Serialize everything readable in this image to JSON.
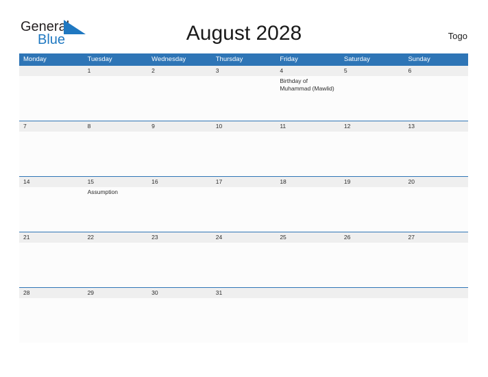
{
  "brand": {
    "word_one": "General",
    "word_two": "Blue",
    "flag_icon": "blue-flag-triangle-icon",
    "color_dark": "#231f20",
    "color_blue": "#1f78c1"
  },
  "header": {
    "title": "August 2028",
    "country": "Togo",
    "header_bg": "#2e75b6",
    "date_band_bg": "#efefef"
  },
  "calendar": {
    "weekdays": [
      "Monday",
      "Tuesday",
      "Wednesday",
      "Thursday",
      "Friday",
      "Saturday",
      "Sunday"
    ],
    "weeks": [
      {
        "days": [
          {
            "num": "",
            "events": []
          },
          {
            "num": "1",
            "events": []
          },
          {
            "num": "2",
            "events": []
          },
          {
            "num": "3",
            "events": []
          },
          {
            "num": "4",
            "events": [
              "Birthday of Muhammad (Mawlid)"
            ]
          },
          {
            "num": "5",
            "events": []
          },
          {
            "num": "6",
            "events": []
          }
        ]
      },
      {
        "days": [
          {
            "num": "7",
            "events": []
          },
          {
            "num": "8",
            "events": []
          },
          {
            "num": "9",
            "events": []
          },
          {
            "num": "10",
            "events": []
          },
          {
            "num": "11",
            "events": []
          },
          {
            "num": "12",
            "events": []
          },
          {
            "num": "13",
            "events": []
          }
        ]
      },
      {
        "days": [
          {
            "num": "14",
            "events": []
          },
          {
            "num": "15",
            "events": [
              "Assumption"
            ]
          },
          {
            "num": "16",
            "events": []
          },
          {
            "num": "17",
            "events": []
          },
          {
            "num": "18",
            "events": []
          },
          {
            "num": "19",
            "events": []
          },
          {
            "num": "20",
            "events": []
          }
        ]
      },
      {
        "days": [
          {
            "num": "21",
            "events": []
          },
          {
            "num": "22",
            "events": []
          },
          {
            "num": "23",
            "events": []
          },
          {
            "num": "24",
            "events": []
          },
          {
            "num": "25",
            "events": []
          },
          {
            "num": "26",
            "events": []
          },
          {
            "num": "27",
            "events": []
          }
        ]
      },
      {
        "days": [
          {
            "num": "28",
            "events": []
          },
          {
            "num": "29",
            "events": []
          },
          {
            "num": "30",
            "events": []
          },
          {
            "num": "31",
            "events": []
          },
          {
            "num": "",
            "events": []
          },
          {
            "num": "",
            "events": []
          },
          {
            "num": "",
            "events": []
          }
        ]
      }
    ]
  }
}
